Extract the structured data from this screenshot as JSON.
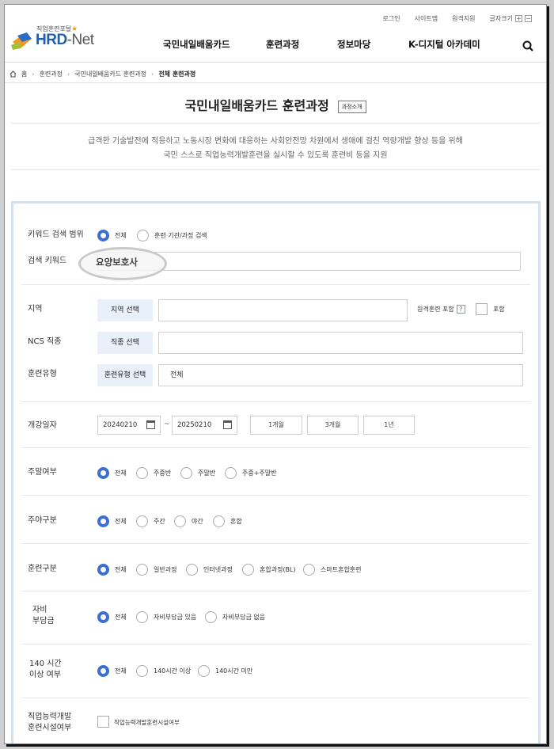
{
  "header": {
    "util_links": [
      "로그인",
      "사이트맵",
      "원격지원"
    ],
    "font_size_label": "글자크기",
    "font_plus": "+",
    "font_minus": "−",
    "logo_small": "직업훈련포털",
    "logo_name_1": "HRD",
    "logo_name_2": "-Net",
    "nav": [
      "국민내일배움카드",
      "훈련과정",
      "정보마당",
      "K-디지털 아카데미"
    ]
  },
  "breadcrumb": {
    "home": "홈",
    "items": [
      "훈련과정",
      "국민내일배움카드 훈련과정",
      "전체 훈련과정"
    ]
  },
  "page": {
    "title": "국민내일배움카드 훈련과정",
    "intro_button": "과정소개",
    "desc_line1": "급격한 기술발전에 적응하고 노동시장 변화에 대응하는 사회안전망 차원에서 생애에 걸친 역량개발 향상 등을 위해",
    "desc_line2": "국민 스스로 직업능력개발훈련을 실시할 수 있도록 훈련비 등을 지원"
  },
  "search": {
    "scope_label": "키워드 검색 범위",
    "scope_options": [
      "전체",
      "훈련 기관/과정 검색"
    ],
    "scope_selected": "전체",
    "keyword_label": "검색 키워드",
    "keyword_value": "요양보호사",
    "region_label": "지역",
    "region_button": "지역 선택",
    "remote_label": "원격훈련 포함",
    "remote_help": "?",
    "remote_checkbox_label": "포함",
    "ncs_label": "NCS 직종",
    "ncs_button": "직종 선택",
    "type_label": "훈련유형",
    "type_button": "훈련유형 선택",
    "type_value": "전체",
    "date_label": "개강일자",
    "date_from": "20240210",
    "date_to": "20250210",
    "date_sep": "~",
    "period_buttons": [
      "1개월",
      "3개월",
      "1년"
    ],
    "weekend_label": "주말여부",
    "weekend_options": [
      "전체",
      "주중반",
      "주말반",
      "주중+주말반"
    ],
    "daynight_label": "주야구분",
    "daynight_options": [
      "전체",
      "주간",
      "야간",
      "혼합"
    ],
    "traintype_label": "훈련구분",
    "traintype_options": [
      "전체",
      "일반과정",
      "인터넷과정",
      "혼합과정(BL)",
      "스마트혼합훈련"
    ],
    "selfpay_label_1": "자비",
    "selfpay_label_2": "부담금",
    "selfpay_options": [
      "전체",
      "자비부담금 있음",
      "자비부담금 없음"
    ],
    "hours_label_1": "140 시간",
    "hours_label_2": "이상 여부",
    "hours_options": [
      "전체",
      "140시간 이상",
      "140시간 미만"
    ],
    "facility_label_1": "직업능력개발",
    "facility_label_2": "훈련시설여부",
    "facility_checkbox_label": "직업능력개발훈련시설여부"
  },
  "colors": {
    "accent": "#3b6fd1",
    "brand": "#1f5fae",
    "select_bg": "#e8f0f9"
  }
}
